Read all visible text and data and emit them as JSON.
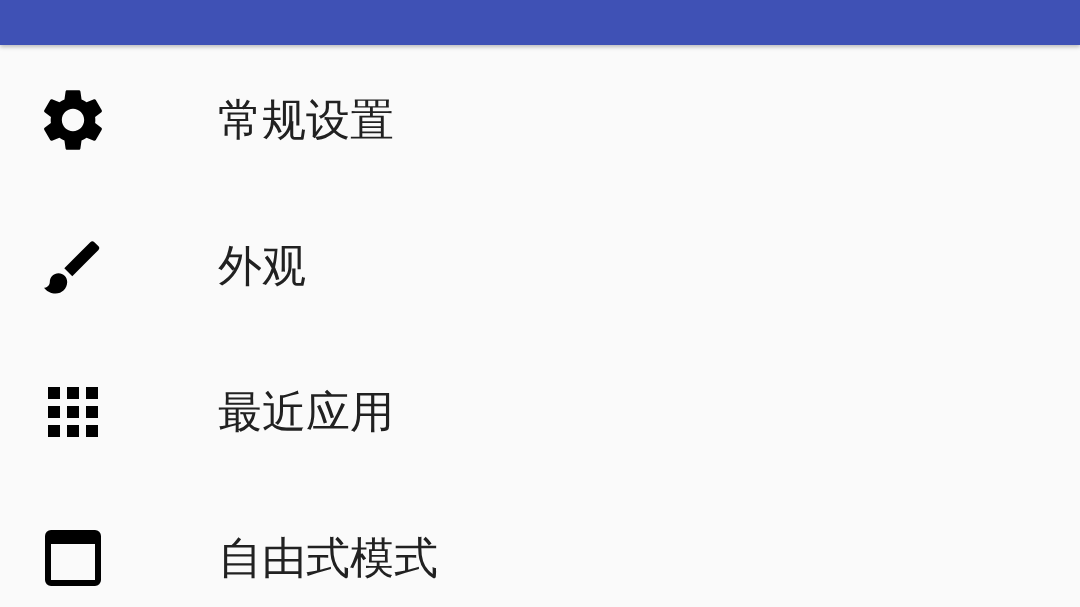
{
  "menu": {
    "items": [
      {
        "label": "常规设置"
      },
      {
        "label": "外观"
      },
      {
        "label": "最近应用"
      },
      {
        "label": "自由式模式"
      }
    ]
  }
}
